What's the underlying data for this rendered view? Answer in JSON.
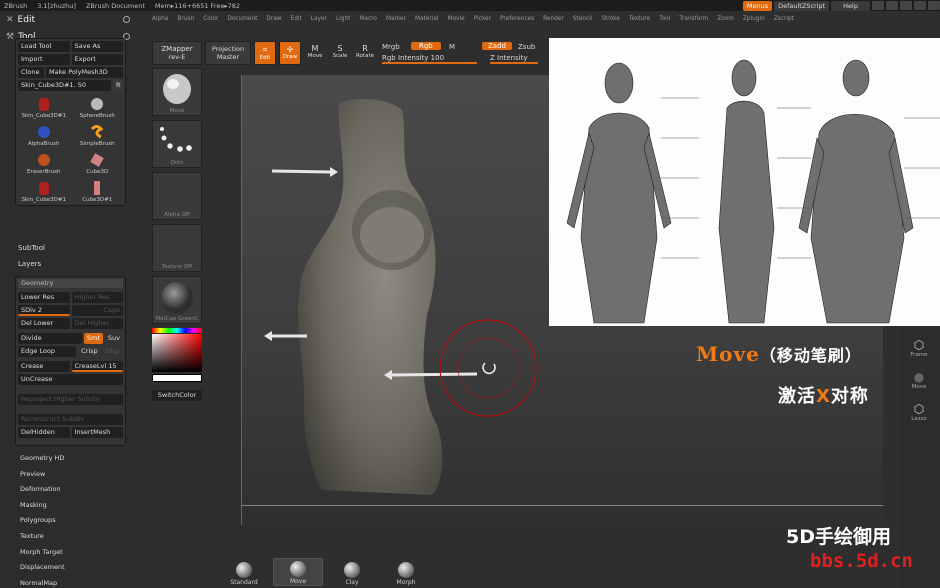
{
  "titlebar": {
    "app": "ZBrush",
    "version": "3.1[zhuzhu]",
    "doc": "ZBrush Document",
    "mem": "Mem▸116+6651 Free▸782",
    "menus": "Menus",
    "script": "DefaultZScript",
    "help": "Help"
  },
  "menubar": [
    "Alpha",
    "Brush",
    "Color",
    "Document",
    "Draw",
    "Edit",
    "Layer",
    "Light",
    "Macro",
    "Marker",
    "Material",
    "Movie",
    "Picker",
    "Preferences",
    "Render",
    "Stencil",
    "Stroke",
    "Texture",
    "Tool",
    "Transform",
    "Zoom",
    "Zplugin",
    "Zscript"
  ],
  "left": {
    "edit": "Edit",
    "tool": "Tool",
    "load_tool": "Load Tool",
    "save_as": "Save As",
    "import": "Import",
    "export": "Export",
    "clone": "Clone",
    "make_polymesh": "Make PolyMesh3D",
    "current_tool": "Skin_Cube3D#1. 50",
    "r": "R",
    "thumbs": [
      "Skin_Cube3D#1",
      "SphereBrush",
      "AlphaBrush",
      "SimpleBrush",
      "EraserBrush",
      "Cube3D",
      "Skin_Cube3D#1",
      "Cube3D#1"
    ],
    "subtool": "SubTool",
    "layers": "Layers",
    "geometry": "Geometry",
    "lower_res": "Lower Res",
    "higher_res": "Higher Res",
    "sdiv": "SDiv 2",
    "cage": "Cage",
    "del_lower": "Del Lower",
    "del_higher": "Del Higher",
    "divide": "Divide",
    "smt": "Smt",
    "suv": "Suv",
    "edge_loop": "Edge Loop",
    "crisp": "Crisp",
    "disp": "Disp",
    "crease": "Crease",
    "crease_lvl": "CreaseLvl 15",
    "uncrease": "UnCrease",
    "reproject": "Reproject Higher Subdiv",
    "reconstruct": "Reconstruct Subdiv",
    "del_hidden": "DelHidden",
    "insert_mesh": "InsertMesh",
    "sections": [
      "Geometry HD",
      "Preview",
      "Deformation",
      "Masking",
      "Polygroups",
      "Texture",
      "Morph Target",
      "Displacement",
      "NormalMap"
    ]
  },
  "topshelf": {
    "zmapper": "ZMapper",
    "zmapper_sub": "rev-E",
    "projection": "Projection",
    "projection_sub": "Master",
    "edit": "Edit",
    "draw": "Draw",
    "move": "Move",
    "scale": "Scale",
    "rotate": "Rotate",
    "mrgb": "Mrgb",
    "rgb": "Rgb",
    "m": "M",
    "rgb_intensity": "Rgb Intensity 100",
    "zadd": "Zadd",
    "zsub": "Zsub",
    "z_intensity": "Z Intensity"
  },
  "leftshelf": [
    "Move",
    "Dots",
    "Alpha Off",
    "Texture Off",
    "MatCap GreenC"
  ],
  "switchcolor": "SwitchColor",
  "rightpanel": [
    "Frame",
    "Move",
    "Lasso"
  ],
  "caption": {
    "move": "Move",
    "cn1": "（移动笔刷）",
    "line2a": "激活",
    "x": "X",
    "line2b": "对称"
  },
  "watermark": {
    "line1": "5D手绘御用",
    "line2": "bbs.5d.cn"
  },
  "bottom_brushes": [
    "Standard",
    "Move",
    "Clay",
    "Morph"
  ],
  "colors": {
    "accent": "#e06a10",
    "caption_orange": "#f07b15",
    "watermark_red": "#e02020"
  }
}
